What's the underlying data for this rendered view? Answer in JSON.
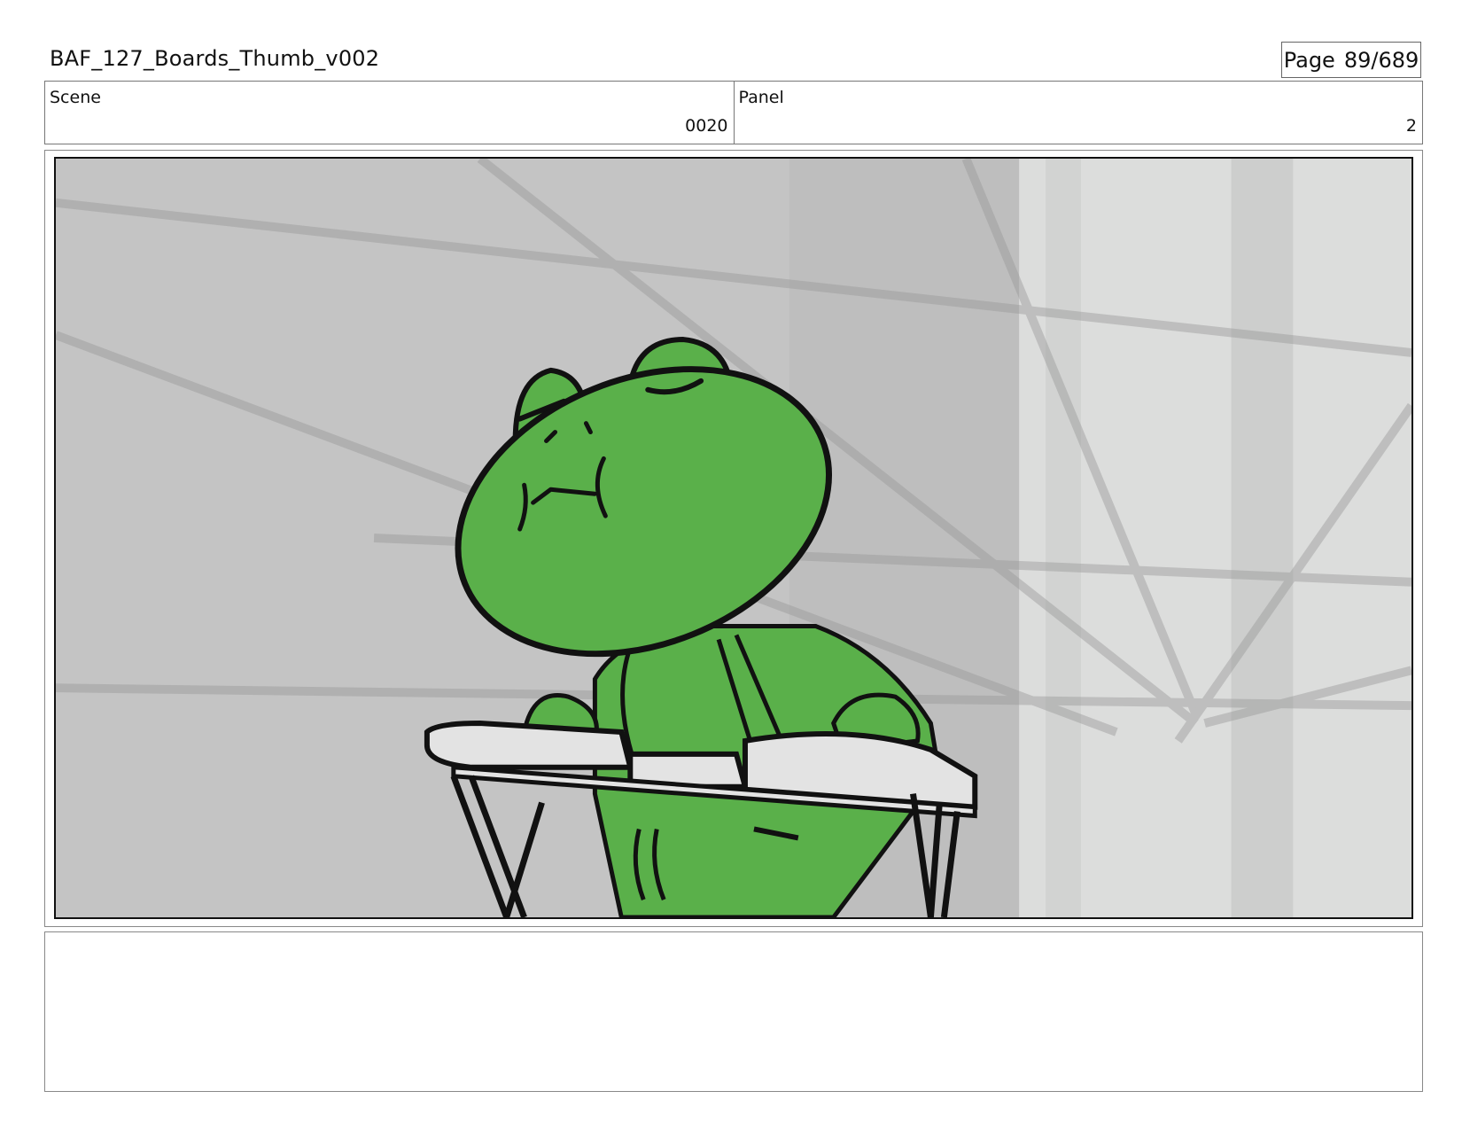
{
  "document": {
    "title": "BAF_127_Boards_Thumb_v002",
    "page_label": "Page",
    "page_number": "89/689"
  },
  "scene": {
    "label": "Scene",
    "value": "0020"
  },
  "panel": {
    "label": "Panel",
    "value": "2"
  },
  "colors": {
    "frog_green": "#5ab04a",
    "outline": "#111111",
    "background_gray": "#c4c4c4",
    "highlight_gray": "#dfe0df",
    "desk_gray": "#e3e3e3"
  },
  "artwork": {
    "subject": "frog-character",
    "expression": "eyes-closed",
    "props": [
      "open-book",
      "lectern-desk"
    ]
  },
  "notes": ""
}
